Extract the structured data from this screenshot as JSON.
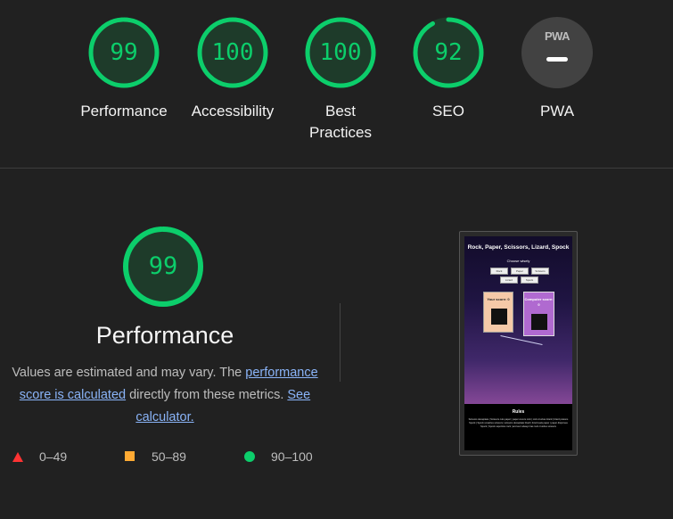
{
  "colors": {
    "pass": "#0cce6b",
    "average": "#ffaa33",
    "fail": "#ff3333",
    "link": "#8ab4f8"
  },
  "gauges": [
    {
      "score": "99",
      "label": "Performance",
      "fraction": 0.99
    },
    {
      "score": "100",
      "label": "Accessibility",
      "fraction": 1.0
    },
    {
      "score": "100",
      "label": "Best Practices",
      "fraction": 1.0
    },
    {
      "score": "92",
      "label": "SEO",
      "fraction": 0.92
    },
    {
      "badge": "PWA",
      "label": "PWA"
    }
  ],
  "performance": {
    "score": "99",
    "fraction": 0.99,
    "title": "Performance",
    "desc_before": "Values are estimated and may vary. The ",
    "desc_link": "performance score is calculated",
    "desc_middle": " directly from these metrics. ",
    "calc_link": "See calculator."
  },
  "legend": [
    {
      "icon": "triangle-fail-icon",
      "range": "0–49"
    },
    {
      "icon": "square-average-icon",
      "range": "50–89"
    },
    {
      "icon": "circle-pass-icon",
      "range": "90–100"
    }
  ],
  "screenshot": {
    "title": "Rock, Paper, Scissors, Lizard, Spock",
    "choose": "Choose wisely",
    "buttons": [
      "Rock",
      "Paper",
      "Scissors",
      "Lizard",
      "Spock"
    ],
    "your_score": "Your score: 0",
    "computer_score": "Computer score: 0",
    "rules_title": "Rules",
    "rules_text": "Scissors decapitate | Scissors cuts paper | paper covers rock | rock crushes lizard | lizard poisons Spock | Spock smashes scissors | scissors decapitate lizard | lizard eats paper | paper disproves Spock | Spock vaporizes rock | and as it always has rock crushes scissors"
  }
}
